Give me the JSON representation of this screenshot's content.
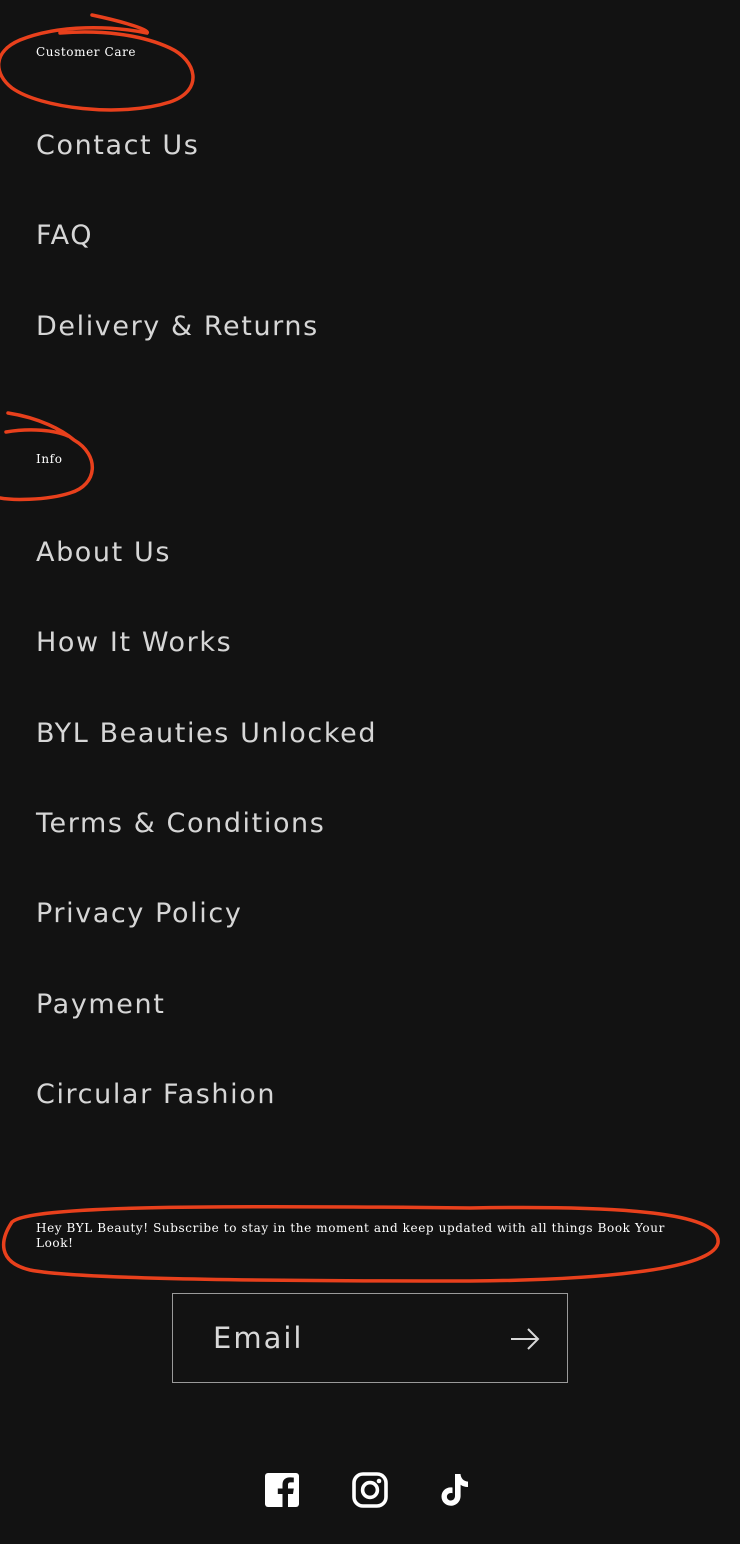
{
  "customer_care": {
    "heading": "Customer Care",
    "links": [
      "Contact Us",
      "FAQ",
      "Delivery & Returns"
    ]
  },
  "info": {
    "heading": "Info",
    "links": [
      "About Us",
      "How It Works",
      "BYL Beauties Unlocked",
      "Terms & Conditions",
      "Privacy Policy",
      "Payment",
      "Circular Fashion"
    ]
  },
  "newsletter": {
    "text": "Hey BYL Beauty! Subscribe to stay in the moment and keep updated with all things Book Your Look!",
    "email_placeholder": "Email",
    "submit_icon": "arrow-right-icon"
  },
  "social": [
    {
      "name": "facebook-icon"
    },
    {
      "name": "instagram-icon"
    },
    {
      "name": "tiktok-icon"
    }
  ],
  "colors": {
    "background": "#121212",
    "text": "#d6d6d6",
    "annotation": "#e8401c"
  }
}
